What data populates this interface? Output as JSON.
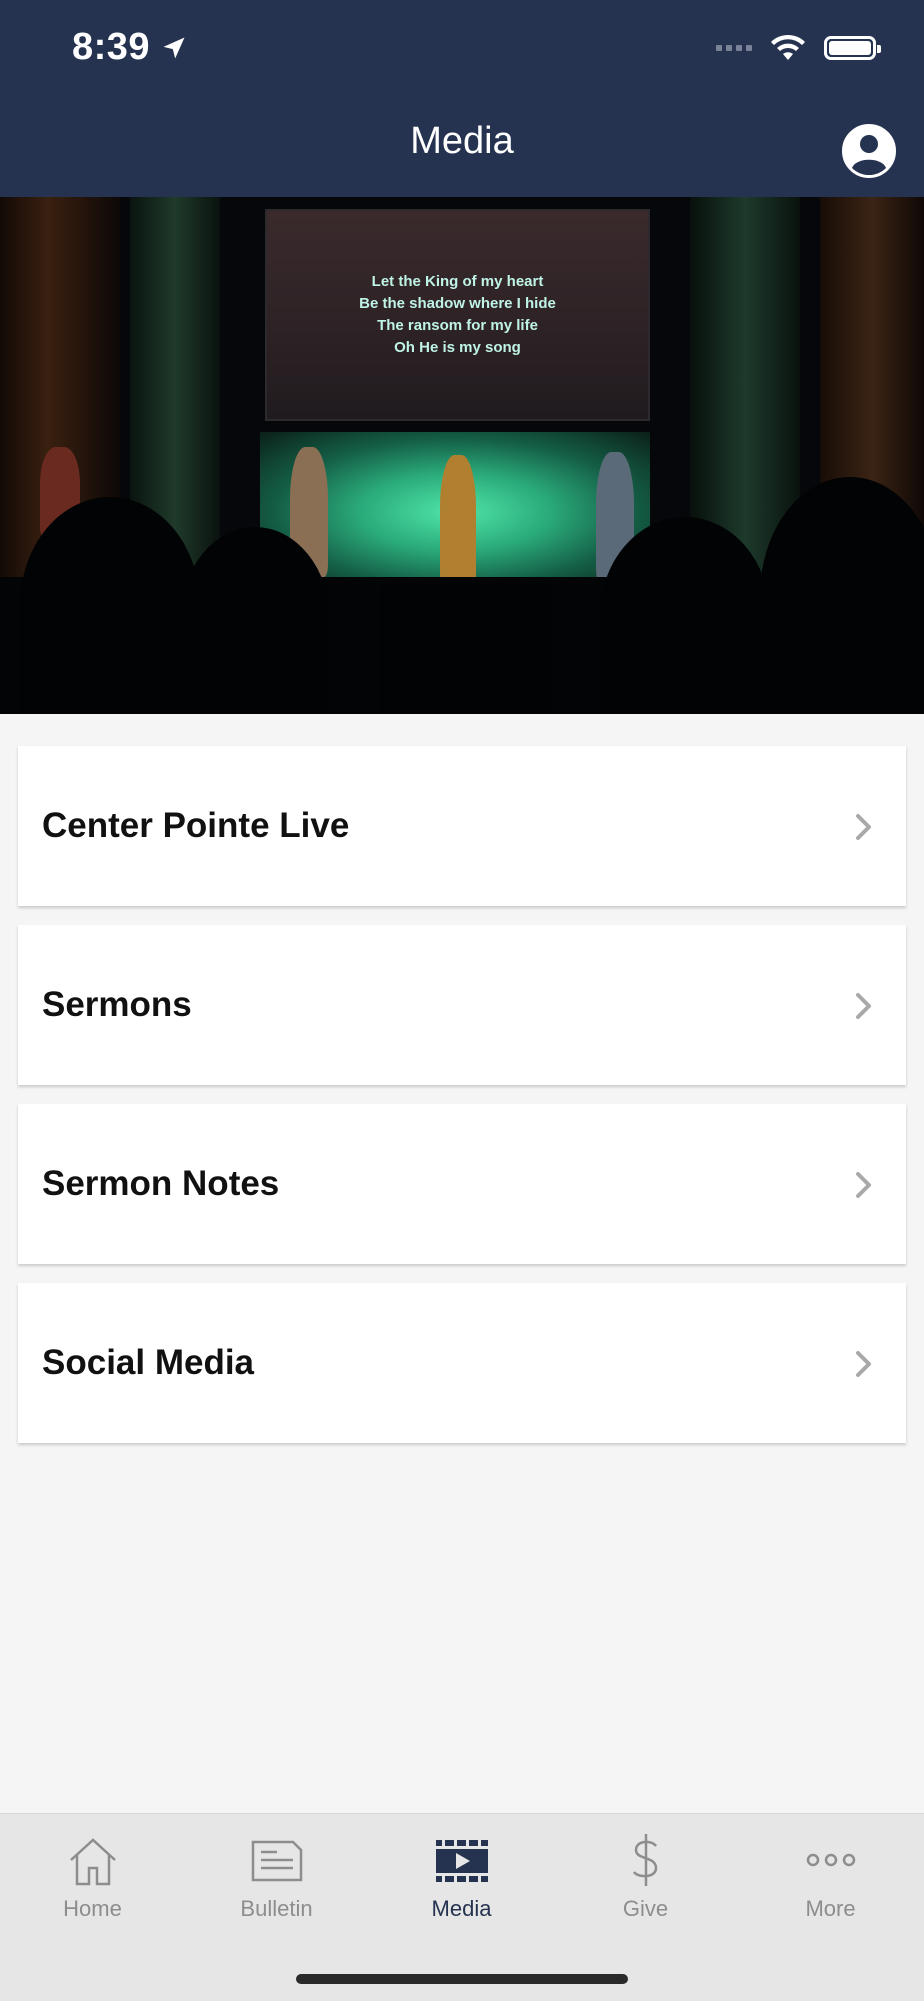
{
  "status": {
    "time": "8:39"
  },
  "header": {
    "title": "Media"
  },
  "hero": {
    "lyrics": [
      "Let the King of my heart",
      "Be the shadow where I hide",
      "The ransom for my life",
      "Oh He is my song"
    ]
  },
  "menu": {
    "items": [
      {
        "label": "Center Pointe Live"
      },
      {
        "label": "Sermons"
      },
      {
        "label": "Sermon Notes"
      },
      {
        "label": "Social Media"
      }
    ]
  },
  "tabbar": {
    "tabs": [
      {
        "label": "Home",
        "icon": "home-icon"
      },
      {
        "label": "Bulletin",
        "icon": "bulletin-icon"
      },
      {
        "label": "Media",
        "icon": "media-icon",
        "active": true
      },
      {
        "label": "Give",
        "icon": "dollar-icon"
      },
      {
        "label": "More",
        "icon": "more-icon"
      }
    ]
  },
  "colors": {
    "header_bg": "#253350",
    "active_tab": "#253350",
    "inactive_tab": "#8d8d8d"
  }
}
